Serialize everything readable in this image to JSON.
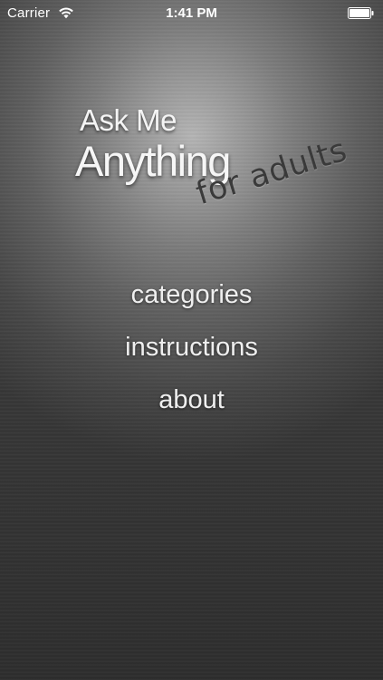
{
  "status_bar": {
    "carrier": "Carrier",
    "time": "1:41 PM",
    "wifi_icon": "wifi-icon",
    "battery_icon": "battery-icon"
  },
  "logo": {
    "line1": "Ask Me",
    "line2": "Anything",
    "line3": "for adults"
  },
  "menu": {
    "items": [
      {
        "label": "categories"
      },
      {
        "label": "instructions"
      },
      {
        "label": "about"
      }
    ]
  },
  "colors": {
    "text": "#efefef",
    "tagline": "#3a3a3a",
    "background_highlight": "#b4b4b4",
    "background_dark": "#373737"
  }
}
